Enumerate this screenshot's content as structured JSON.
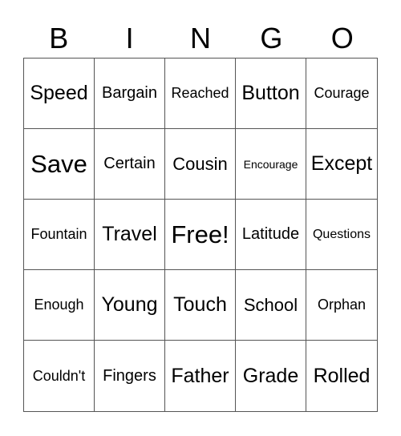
{
  "header": {
    "letters": [
      "B",
      "I",
      "N",
      "G",
      "O"
    ]
  },
  "cells": [
    {
      "text": "Speed",
      "size": "l"
    },
    {
      "text": "Bargain",
      "size": "m"
    },
    {
      "text": "Reached",
      "size": "s"
    },
    {
      "text": "Button",
      "size": "l"
    },
    {
      "text": "Courage",
      "size": "s"
    },
    {
      "text": "Save",
      "size": "xl"
    },
    {
      "text": "Certain",
      "size": "m"
    },
    {
      "text": "Cousin",
      "size": "ml"
    },
    {
      "text": "Encourage",
      "size": "xs"
    },
    {
      "text": "Except",
      "size": "l"
    },
    {
      "text": "Fountain",
      "size": "s"
    },
    {
      "text": "Travel",
      "size": "l"
    },
    {
      "text": "Free!",
      "size": "xl"
    },
    {
      "text": "Latitude",
      "size": "m"
    },
    {
      "text": "Questions",
      "size": "s2"
    },
    {
      "text": "Enough",
      "size": "s"
    },
    {
      "text": "Young",
      "size": "l"
    },
    {
      "text": "Touch",
      "size": "l"
    },
    {
      "text": "School",
      "size": "ml"
    },
    {
      "text": "Orphan",
      "size": "s"
    },
    {
      "text": "Couldn't",
      "size": "s"
    },
    {
      "text": "Fingers",
      "size": "m"
    },
    {
      "text": "Father",
      "size": "l"
    },
    {
      "text": "Grade",
      "size": "l"
    },
    {
      "text": "Rolled",
      "size": "l"
    }
  ]
}
